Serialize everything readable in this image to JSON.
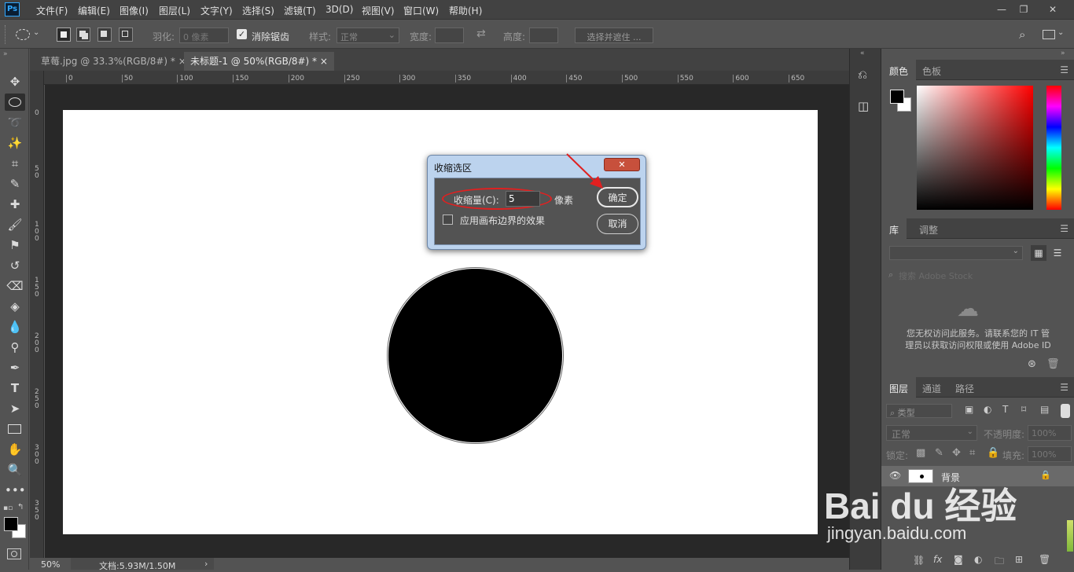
{
  "app": {
    "logo_text": "Ps"
  },
  "menu": [
    "文件(F)",
    "编辑(E)",
    "图像(I)",
    "图层(L)",
    "文字(Y)",
    "选择(S)",
    "滤镜(T)",
    "3D(D)",
    "视图(V)",
    "窗口(W)",
    "帮助(H)"
  ],
  "options_bar": {
    "feather_label": "羽化:",
    "feather_value": "0 像素",
    "antialias_label": "消除锯齿",
    "style_label": "样式:",
    "style_value": "正常",
    "width_label": "宽度:",
    "height_label": "高度:",
    "select_mask_label": "选择并遮住 ..."
  },
  "tabs": [
    {
      "label": "草莓.jpg @ 33.3%(RGB/8#) *",
      "close": "×"
    },
    {
      "label": "未标题-1 @ 50%(RGB/8#) *",
      "close": "×"
    }
  ],
  "ruler_h_ticks": [
    "0",
    "50",
    "100",
    "150",
    "200",
    "250",
    "300",
    "350",
    "400",
    "450",
    "500",
    "550",
    "600",
    "650"
  ],
  "ruler_v_ticks": [
    "0",
    "5\n0",
    "1\n0\n0",
    "1\n5\n0",
    "2\n0\n0",
    "2\n5\n0",
    "3\n0\n0",
    "3\n5\n0"
  ],
  "status": {
    "zoom": "50%",
    "doc": "文档:5.93M/1.50M",
    "arrow": "›"
  },
  "dialog": {
    "title": "收缩选区",
    "amount_label": "收缩量(C):",
    "amount_value": "5",
    "unit": "像素",
    "checkbox_label": "应用画布边界的效果",
    "ok": "确定",
    "cancel": "取消",
    "close": "✕"
  },
  "color_panel": {
    "tabs": [
      "颜色",
      "色板"
    ],
    "fg_color": "#000000",
    "bg_color": "#ffffff"
  },
  "library_panel": {
    "tabs": [
      "库",
      "调整"
    ],
    "search_placeholder": "搜索 Adobe Stock",
    "message_line1": "您无权访问此服务。请联系您的 IT 管",
    "message_line2": "理员以获取访问权限或使用 Adobe ID"
  },
  "layers_panel": {
    "tabs": [
      "图层",
      "通道",
      "路径"
    ],
    "filter_label": "类型",
    "blend_mode": "正常",
    "opacity_label": "不透明度:",
    "opacity_value": "100%",
    "lock_label": "锁定:",
    "fill_label": "填充:",
    "fill_value": "100%",
    "layers": [
      {
        "name": "背景",
        "locked": true
      }
    ]
  },
  "watermark": {
    "brand": "Bai du 经验",
    "url": "jingyan.baidu.com"
  }
}
